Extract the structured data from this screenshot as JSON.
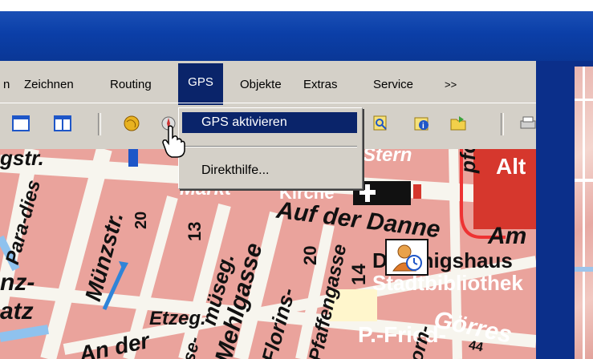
{
  "menubar": {
    "items": [
      {
        "label": "n"
      },
      {
        "label": "Zeichnen"
      },
      {
        "label": "Routing"
      },
      {
        "label": "GPS"
      },
      {
        "label": "Objekte"
      },
      {
        "label": "Extras"
      },
      {
        "label": "Service"
      },
      {
        "label": ">>"
      }
    ],
    "active": "GPS"
  },
  "dropdown": {
    "items": [
      {
        "label": "GPS aktivieren",
        "selected": true
      },
      {
        "label": "Direkthilfe..."
      }
    ]
  },
  "map": {
    "labels": {
      "gstr": "gstr.",
      "markt": "Markt",
      "kirche": "Kirche",
      "stern": "Stern",
      "alt": "Alt",
      "pfort": "pfort",
      "auf_der_danne": "Auf der Danne",
      "am": "Am",
      "para_dies": "Para-dies",
      "muenzstr": "Münzstr.",
      "num20a": "20",
      "num13": "13",
      "museg": "müseg.",
      "num20b": "20",
      "florins": "Florins-",
      "num14": "14",
      "koenigshaus": "D   Königshaus",
      "stadtbibliothek": "Stadtbibliothek",
      "nz": "nz-",
      "atz": "atz",
      "etzeg": "Etzeg.",
      "mehlgasse": "Mehlgasse",
      "pfaffengasse": "Pfaffengasse",
      "an_der": "An der",
      "pfried": "P.-Fried-",
      "goerres": "Görres",
      "num44": "44",
      "se": "se-",
      "orn": "orn-"
    }
  },
  "colors": {
    "title_blue": "#0b3fa8",
    "selection": "#0a246a",
    "chrome": "#d4d0c8",
    "map_block": "#eaa39c",
    "road": "#f7f5ee",
    "water": "#8fc2ee"
  }
}
